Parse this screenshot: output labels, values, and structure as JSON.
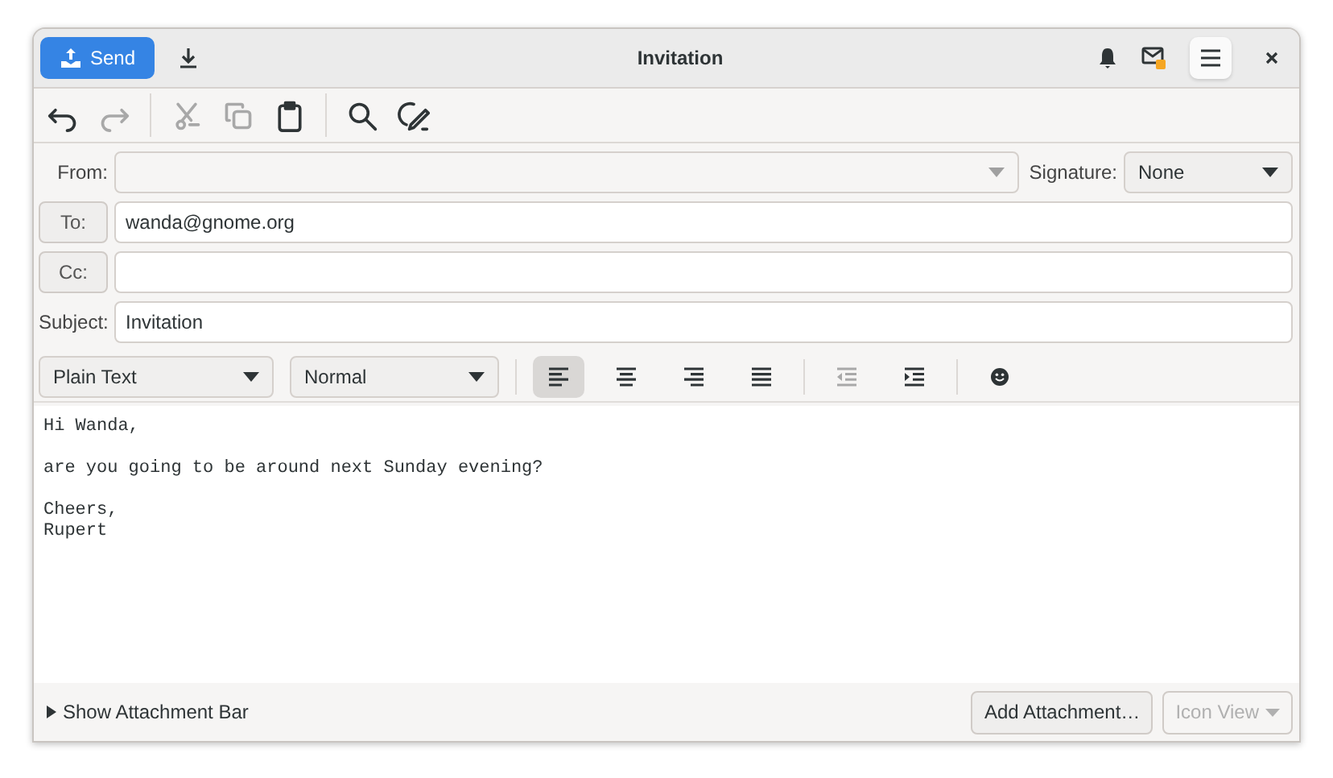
{
  "window": {
    "title": "Invitation"
  },
  "headerbar": {
    "send": "Send"
  },
  "toolbar": [
    {
      "kind": "undo",
      "disabled": false
    },
    {
      "kind": "redo",
      "disabled": true
    },
    {
      "kind": "cut",
      "disabled": true
    },
    {
      "kind": "copy",
      "disabled": true
    },
    {
      "kind": "paste",
      "disabled": false
    },
    {
      "kind": "find",
      "disabled": false
    },
    {
      "kind": "spellcheck",
      "disabled": false
    }
  ],
  "from": {
    "label": "From:"
  },
  "signature": {
    "label": "Signature:",
    "value": "None"
  },
  "to": {
    "label": "To:",
    "value": "wanda@gnome.org"
  },
  "cc": {
    "label": "Cc:"
  },
  "subject": {
    "label": "Subject:",
    "value": "Invitation"
  },
  "format": {
    "mode": "Plain Text",
    "style": "Normal",
    "align": [
      {
        "kind": "left",
        "selected": true
      },
      {
        "kind": "center",
        "selected": false
      },
      {
        "kind": "right",
        "selected": false
      },
      {
        "kind": "justify",
        "selected": false
      }
    ],
    "indent": [
      {
        "kind": "outdent",
        "disabled": true
      },
      {
        "kind": "indent",
        "disabled": false
      }
    ]
  },
  "body": [
    {
      "lines": [
        "Hi Wanda,"
      ]
    },
    {
      "lines": [
        "are you going to be around next Sunday evening?"
      ]
    },
    {
      "lines": [
        "Cheers,",
        "Rupert"
      ]
    }
  ],
  "footer": {
    "expander": "Show Attachment Bar",
    "expanded": false,
    "add": "Add Attachment…",
    "view": {
      "label": "Icon View",
      "disabled": true
    }
  }
}
